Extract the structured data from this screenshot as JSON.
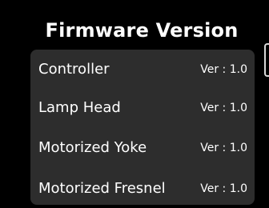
{
  "header": {
    "title": "Firmware Version"
  },
  "versions": [
    {
      "name": "Controller",
      "version": "Ver : 1.0"
    },
    {
      "name": "Lamp Head",
      "version": "Ver : 1.0"
    },
    {
      "name": "Motorized Yoke",
      "version": "Ver : 1.0"
    },
    {
      "name": "Motorized Fresnel",
      "version": "Ver : 1.0"
    }
  ],
  "colors": {
    "background": "#000000",
    "panel": "#2d2d2d",
    "text": "#ffffff"
  }
}
